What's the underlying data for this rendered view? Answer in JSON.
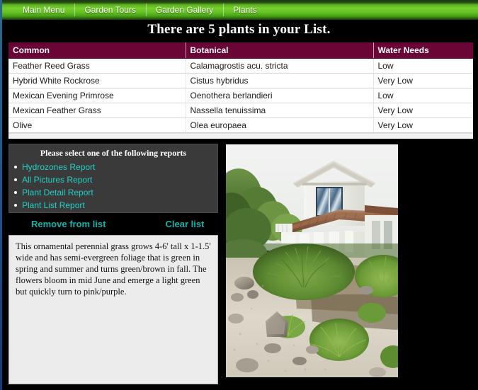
{
  "nav": {
    "items": [
      {
        "label": "Main Menu"
      },
      {
        "label": "Garden Tours"
      },
      {
        "label": "Garden Gallery"
      },
      {
        "label": "Plants"
      }
    ]
  },
  "header": {
    "title": "There are 5 plants in your List."
  },
  "table": {
    "columns": [
      "Common",
      "Botanical",
      "Water Needs"
    ],
    "rows": [
      {
        "common": "Feather Reed Grass",
        "botanical": "Calamagrostis acu. stricta",
        "water": "Low"
      },
      {
        "common": "Hybrid White Rockrose",
        "botanical": "Cistus hybridus",
        "water": "Very Low"
      },
      {
        "common": "Mexican Evening Primrose",
        "botanical": "Oenothera berlandieri",
        "water": "Low"
      },
      {
        "common": "Mexican Feather Grass",
        "botanical": "Nassella tenuissima",
        "water": "Very Low"
      },
      {
        "common": "Olive",
        "botanical": "Olea europaea",
        "water": "Very Low"
      }
    ]
  },
  "reports": {
    "heading": "Please select one of the following reports",
    "items": [
      {
        "label": "Hydrozones Report"
      },
      {
        "label": "All Pictures Report"
      },
      {
        "label": "Plant Detail Report"
      },
      {
        "label": "Plant List Report"
      }
    ]
  },
  "actions": {
    "remove_label": "Remove from list",
    "clear_label": "Clear list"
  },
  "description": {
    "text": "This ornamental perennial grass grows 4-6' tall x 1-1.5' wide and has semi-evergreen foliage that is green in spring and summer and turns green/brown in fall. The flowers bloom in mid June and emerge a light green but quickly turn to pink/purple."
  },
  "photo": {
    "alt": "Photograph of ornamental feather reed grass planted in a gravel bed in front of a white two-story stucco house with a terracotta tile roof"
  },
  "colors": {
    "nav_green": "#76d12b",
    "table_header": "#6b0535",
    "link_teal": "#12b3ab",
    "report_link": "#25d0c8",
    "panel_gray": "#3a3a3a",
    "page_bg": "#000000",
    "description_bg": "#ececec"
  }
}
